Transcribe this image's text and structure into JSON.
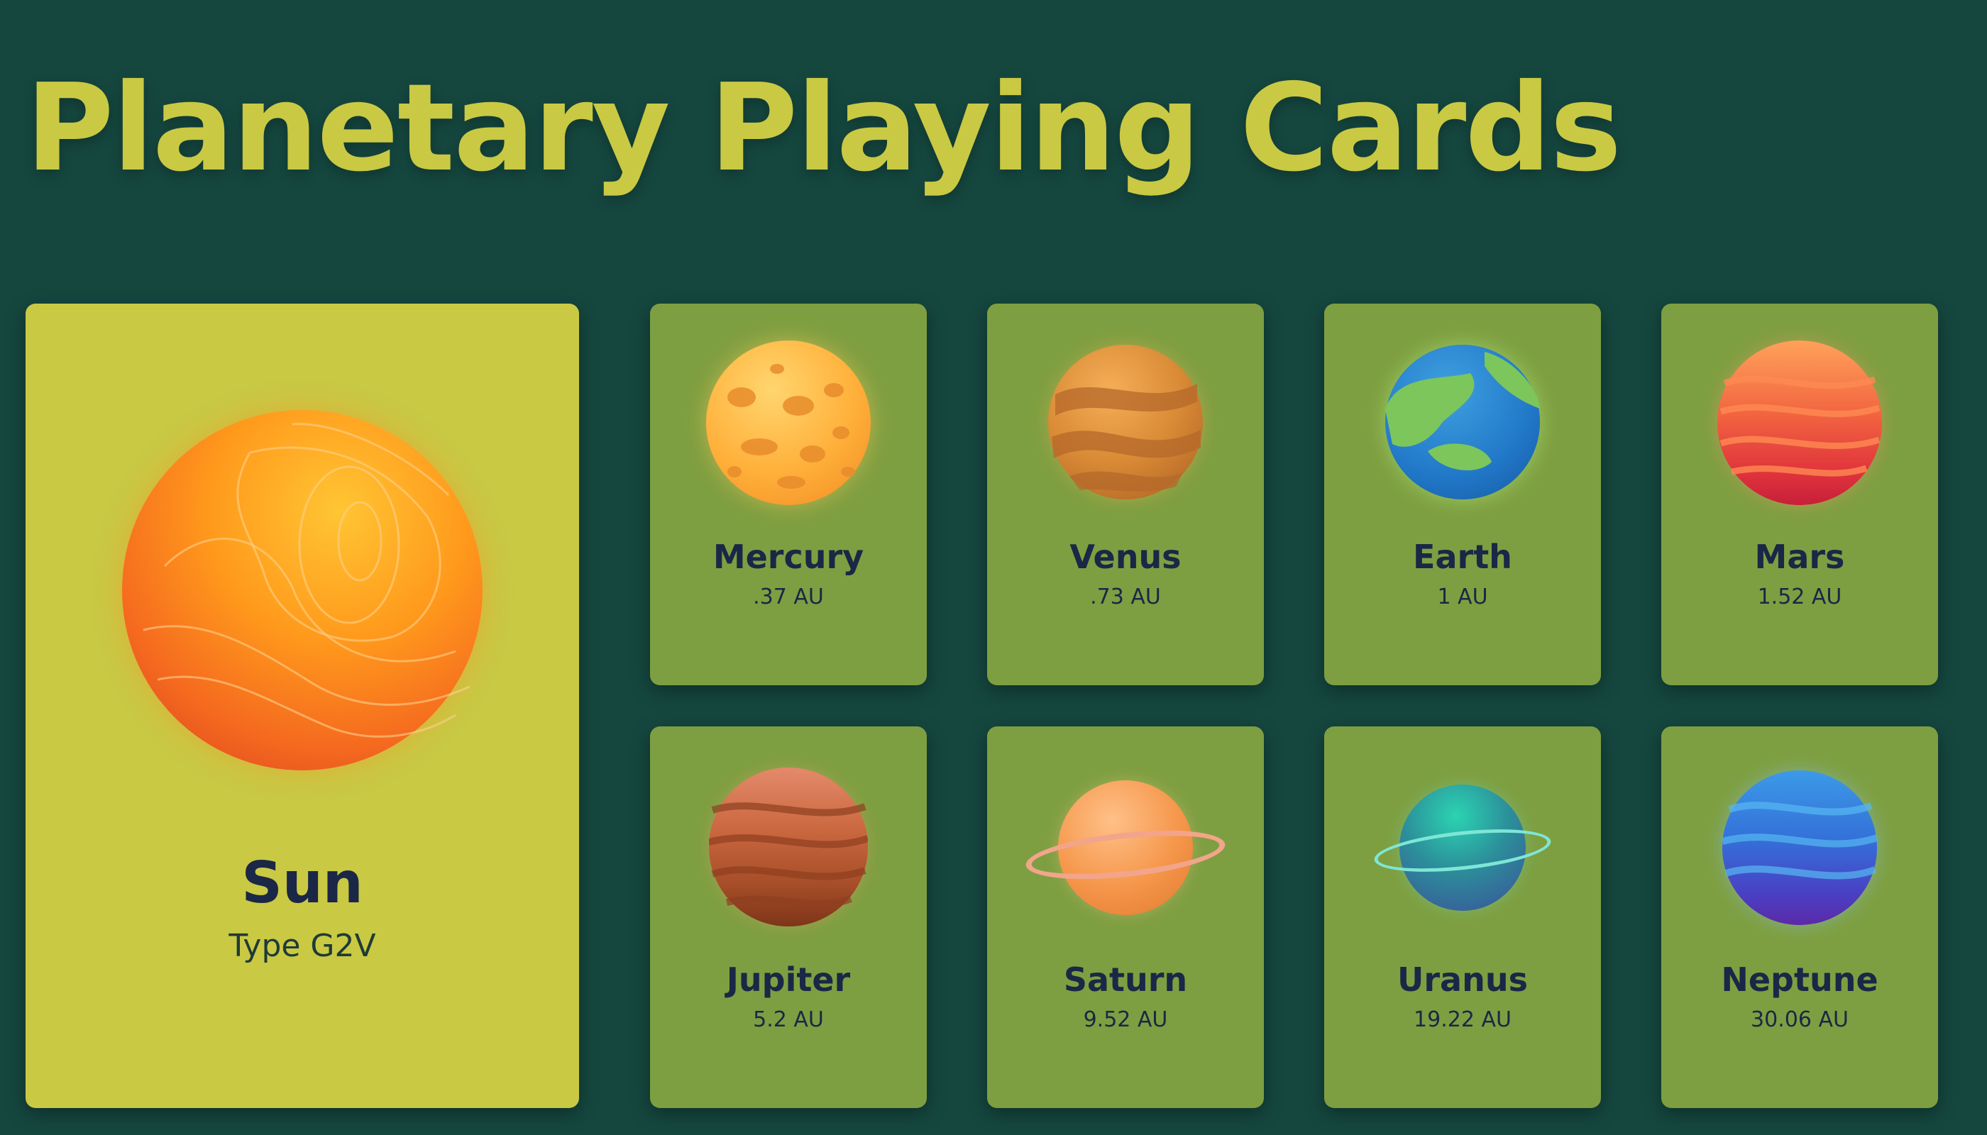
{
  "page": {
    "title": "Planetary Playing Cards"
  },
  "sun": {
    "name": "Sun",
    "subtitle": "Type G2V",
    "icon": "sun-icon"
  },
  "planets": [
    {
      "name": "Mercury",
      "distance": ".37 AU",
      "icon": "mercury-icon"
    },
    {
      "name": "Venus",
      "distance": ".73 AU",
      "icon": "venus-icon"
    },
    {
      "name": "Earth",
      "distance": "1 AU",
      "icon": "earth-icon"
    },
    {
      "name": "Mars",
      "distance": "1.52 AU",
      "icon": "mars-icon"
    },
    {
      "name": "Jupiter",
      "distance": "5.2 AU",
      "icon": "jupiter-icon"
    },
    {
      "name": "Saturn",
      "distance": "9.52 AU",
      "icon": "saturn-icon"
    },
    {
      "name": "Uranus",
      "distance": "19.22 AU",
      "icon": "uranus-icon"
    },
    {
      "name": "Neptune",
      "distance": "30.06 AU",
      "icon": "neptune-icon"
    }
  ],
  "colors": {
    "background": "#15473f",
    "title": "#c9c944",
    "sun_card": "#c9c944",
    "planet_card": "#7e9f41",
    "card_text": "#1b2746"
  }
}
